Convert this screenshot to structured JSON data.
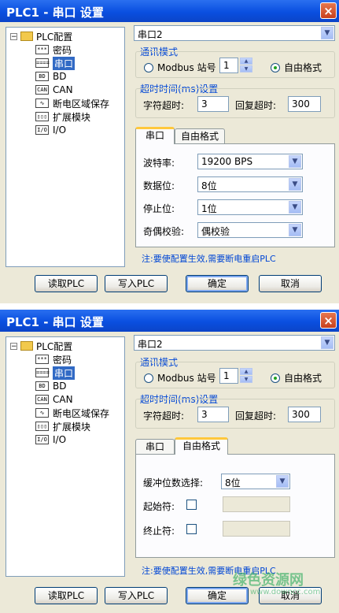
{
  "windows": [
    {
      "title": "PLC1 - 串口 设置",
      "close_glyph": "×",
      "tree": {
        "root": "PLC配置",
        "items": [
          {
            "label": "密码",
            "icon": "password-icon",
            "icon_text": "***"
          },
          {
            "label": "串口",
            "icon": "serial-port-icon",
            "icon_text": "===="
          },
          {
            "label": "BD",
            "icon": "bd-icon",
            "icon_text": "BD"
          },
          {
            "label": "CAN",
            "icon": "can-icon",
            "icon_text": "CAN"
          },
          {
            "label": "断电区域保存",
            "icon": "power-save-icon",
            "icon_text": "∿"
          },
          {
            "label": "扩展模块",
            "icon": "expansion-module-icon",
            "icon_text": "▯▯▯"
          },
          {
            "label": "I/O",
            "icon": "io-icon",
            "icon_text": "I/O"
          }
        ],
        "selected": "串口"
      },
      "port_select": "串口2",
      "comm_mode": {
        "title": "通讯模式",
        "modbus_label": "Modbus 站号",
        "station_no": "1",
        "free_label": "自由格式",
        "selected": "自由格式"
      },
      "timeout": {
        "title": "超时时间(ms)设置",
        "char_label": "字符超时:",
        "char_value": "3",
        "reply_label": "回复超时:",
        "reply_value": "300"
      },
      "tabs": [
        "串口",
        "自由格式"
      ],
      "active_tab": "串口",
      "serial_tab": {
        "baud_label": "波特率:",
        "baud_value": "19200 BPS",
        "data_label": "数据位:",
        "data_value": "8位",
        "stop_label": "停止位:",
        "stop_value": "1位",
        "parity_label": "奇偶校验:",
        "parity_value": "偶校验"
      },
      "note": "注:要使配置生效,需要断电重启PLC",
      "buttons": {
        "read": "读取PLC",
        "write": "写入PLC",
        "ok": "确定",
        "cancel": "取消"
      }
    },
    {
      "title": "PLC1 - 串口 设置",
      "close_glyph": "×",
      "tree": {
        "root": "PLC配置",
        "items": [
          {
            "label": "密码",
            "icon": "password-icon",
            "icon_text": "***"
          },
          {
            "label": "串口",
            "icon": "serial-port-icon",
            "icon_text": "===="
          },
          {
            "label": "BD",
            "icon": "bd-icon",
            "icon_text": "BD"
          },
          {
            "label": "CAN",
            "icon": "can-icon",
            "icon_text": "CAN"
          },
          {
            "label": "断电区域保存",
            "icon": "power-save-icon",
            "icon_text": "∿"
          },
          {
            "label": "扩展模块",
            "icon": "expansion-module-icon",
            "icon_text": "▯▯▯"
          },
          {
            "label": "I/O",
            "icon": "io-icon",
            "icon_text": "I/O"
          }
        ],
        "selected": "串口"
      },
      "port_select": "串口2",
      "comm_mode": {
        "title": "通讯模式",
        "modbus_label": "Modbus 站号",
        "station_no": "1",
        "free_label": "自由格式",
        "selected": "自由格式"
      },
      "timeout": {
        "title": "超时时间(ms)设置",
        "char_label": "字符超时:",
        "char_value": "3",
        "reply_label": "回复超时:",
        "reply_value": "300"
      },
      "tabs": [
        "串口",
        "自由格式"
      ],
      "active_tab": "自由格式",
      "free_tab": {
        "buffer_label": "缓冲位数选择:",
        "buffer_value": "8位",
        "start_label": "起始符:",
        "end_label": "终止符:"
      },
      "note": "注:要使配置生效,需要断电重启PLC",
      "buttons": {
        "read": "读取PLC",
        "write": "写入PLC",
        "ok": "确定",
        "cancel": "取消"
      }
    }
  ],
  "watermark": {
    "main": "绿色资源网",
    "sub": "www.downcc.com"
  },
  "colors": {
    "title_bar": "#0a4fe0",
    "selection": "#316ac5",
    "group_title": "#0046d5",
    "dialog_bg": "#ece9d8"
  }
}
